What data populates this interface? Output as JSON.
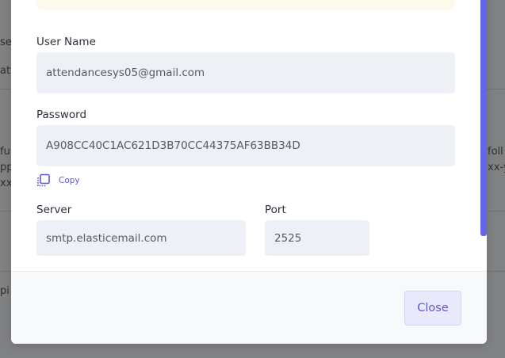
{
  "background": {
    "fragments": [
      "ser",
      "att",
      "fu",
      "pp",
      "xx.x",
      "foll",
      "xx-y",
      "pi"
    ]
  },
  "modal": {
    "username": {
      "label": "User Name",
      "value": "attendancesys05@gmail.com"
    },
    "password": {
      "label": "Password",
      "value": "A908CC40C1AC621D3B70CC44375AF63BB34D"
    },
    "copy": {
      "label": "Copy",
      "icon": "copy-icon"
    },
    "server": {
      "label": "Server",
      "value": "smtp.elasticemail.com"
    },
    "port": {
      "label": "Port",
      "value": "2525"
    },
    "footer": {
      "close_label": "Close"
    }
  },
  "colors": {
    "accent": "#5b5bd6",
    "input_bg": "#edf1f5",
    "scrollbar": "#6266e8",
    "notice_bg": "#fdf9ec"
  }
}
